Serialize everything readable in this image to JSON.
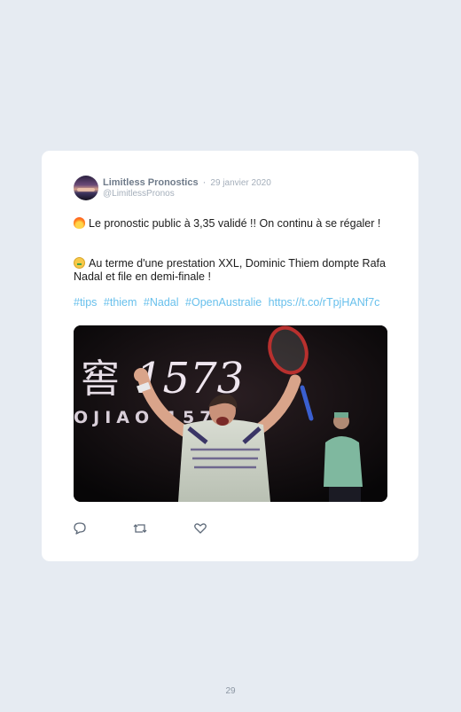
{
  "tweet": {
    "author_name": "Limitless Pronostics",
    "separator": "·",
    "date": "29 janvier 2020",
    "handle": "@LimitlessPronos",
    "line1": "Le pronostic public à 3,35 validé !! On continu à se régaler !",
    "line2": "Au terme d'une prestation XXL, Dominic Thiem dompte Rafa Nadal et file en demi-finale !",
    "hashtags": [
      "#tips",
      "#thiem",
      "#Nadal",
      "#OpenAustralie"
    ],
    "link": "https://t.co/rTpjHANf7c",
    "line1_icon": "fire-emoji",
    "line2_icon": "money-mouth-emoji",
    "photo": {
      "banner_text": "1573",
      "banner_chinese": "窖",
      "banner_sub": "OJIAO   1573"
    },
    "actions": [
      "reply-icon",
      "retweet-icon",
      "like-icon"
    ]
  },
  "page": {
    "number": "29"
  },
  "colors": {
    "background": "#e6ebf2",
    "card": "#ffffff",
    "link": "#68c0ec",
    "meta": "#a5afbb"
  }
}
